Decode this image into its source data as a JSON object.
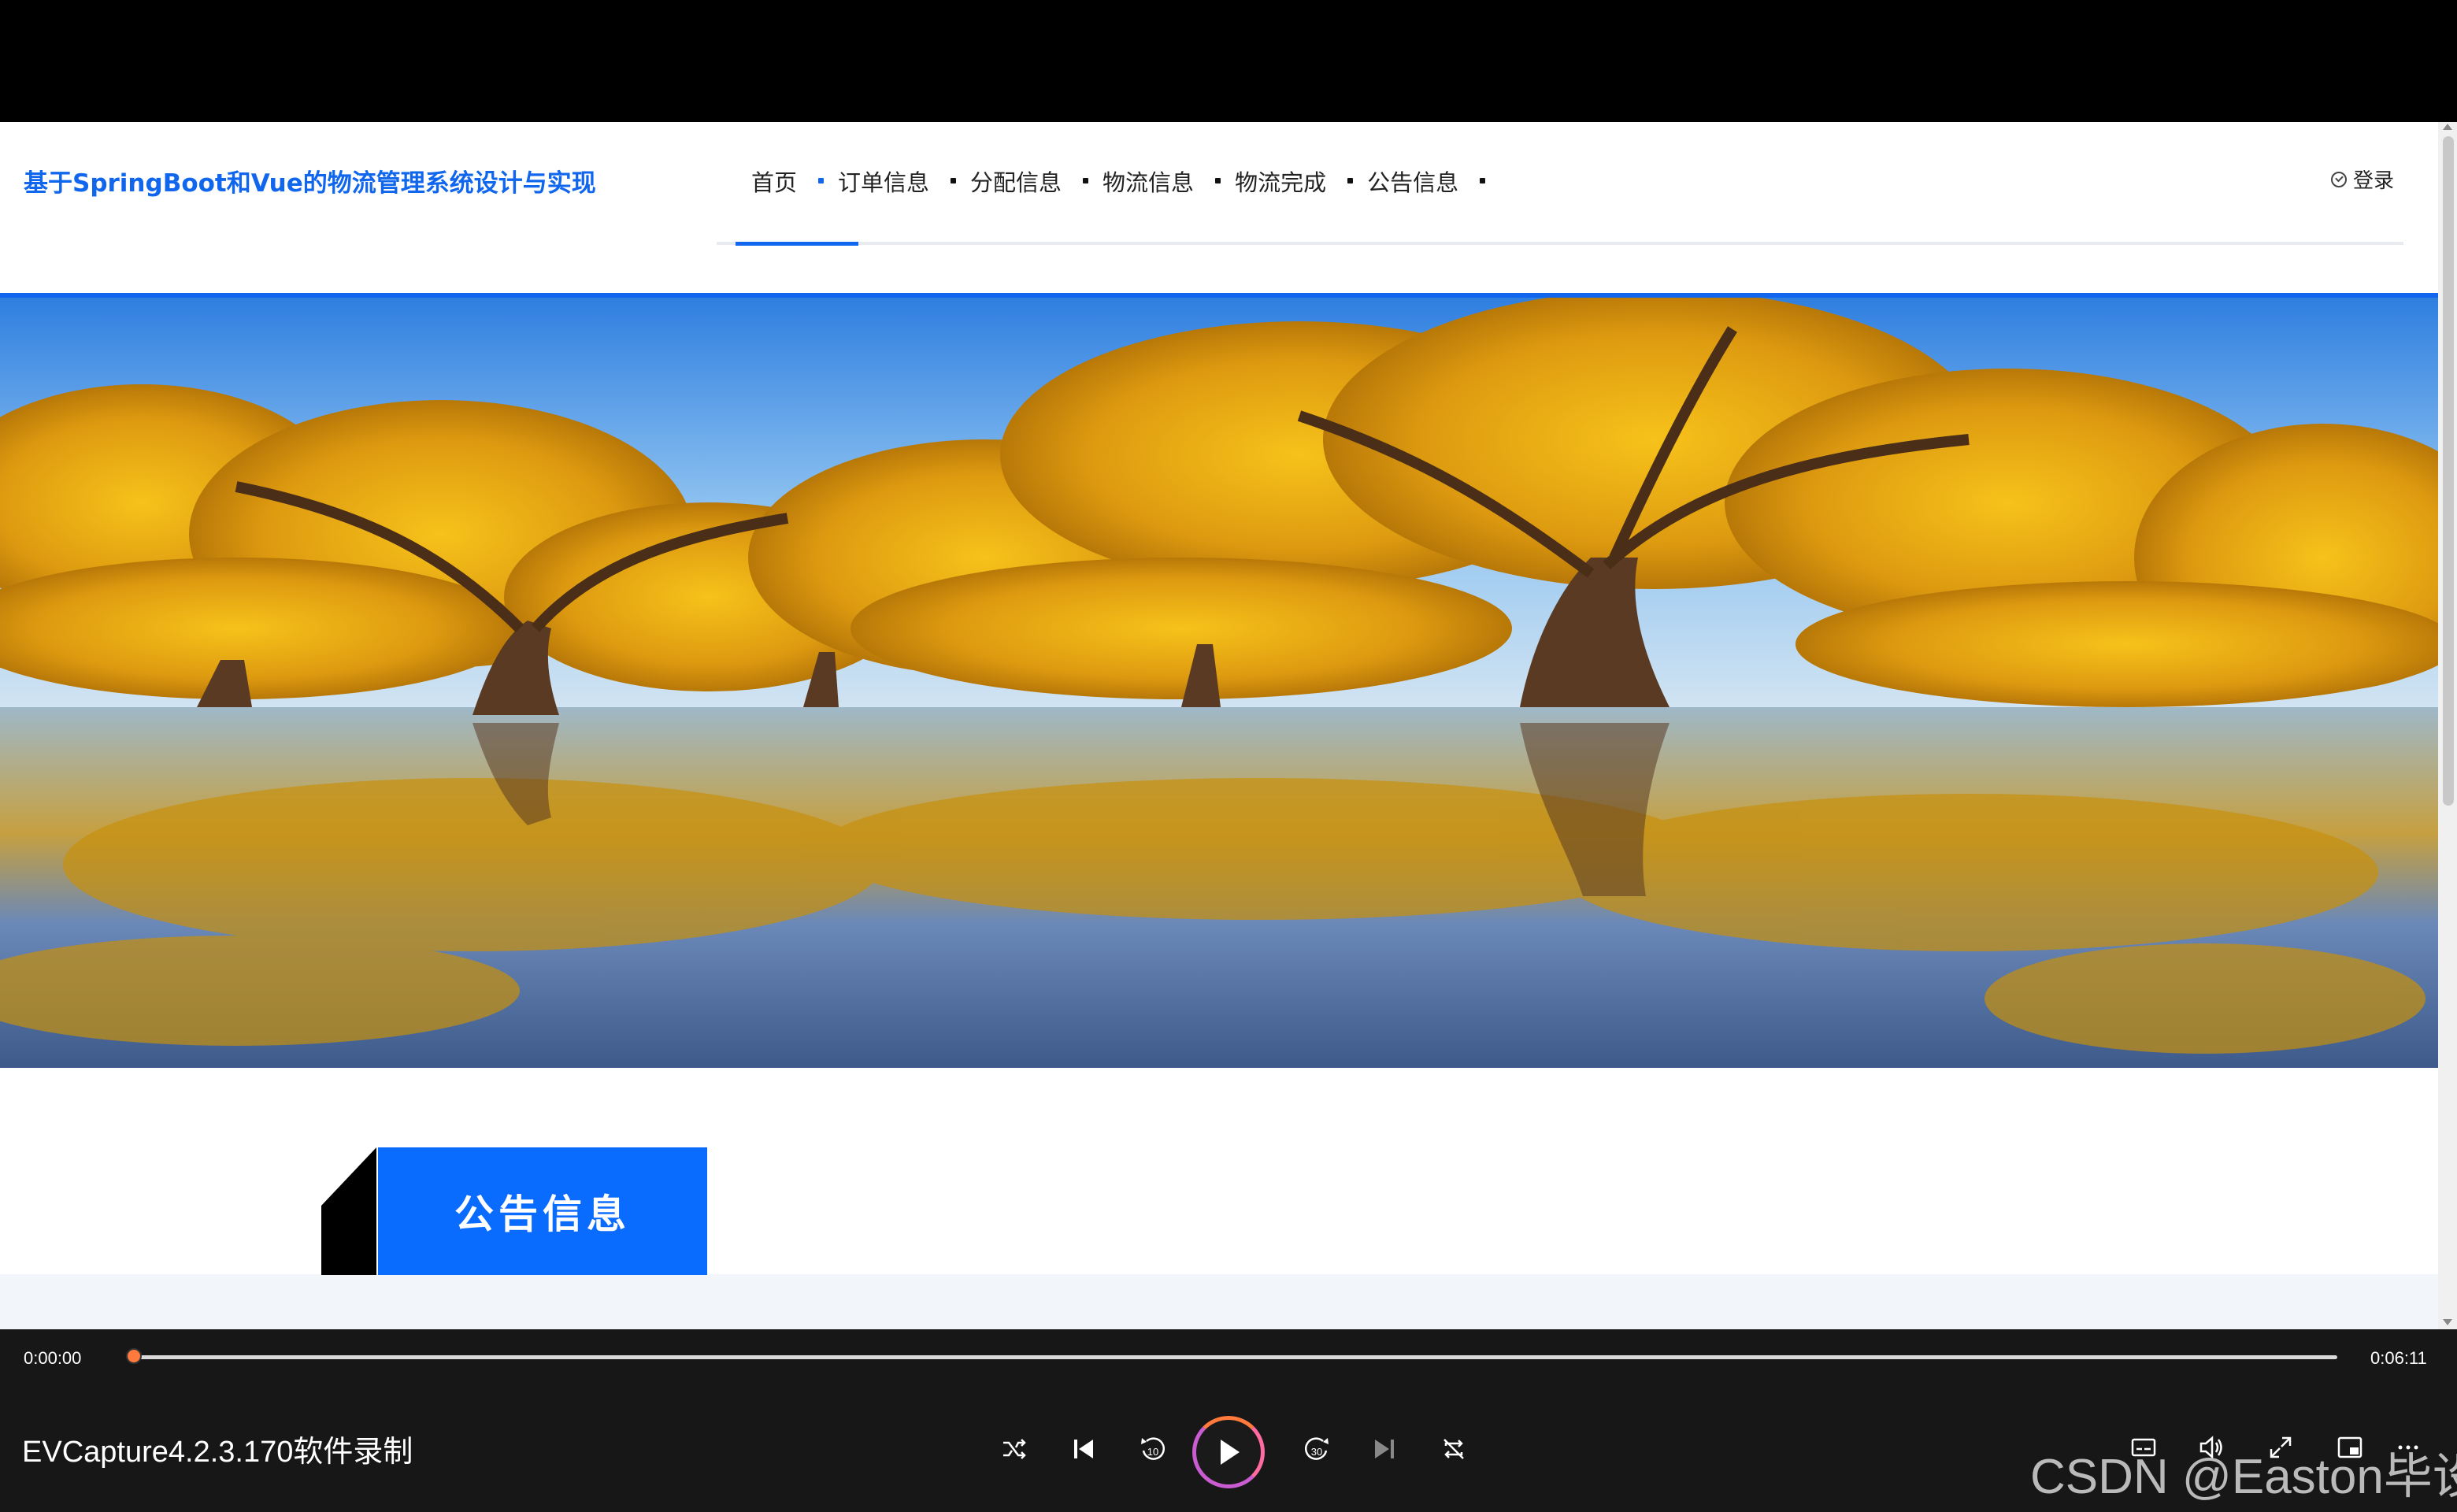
{
  "site": {
    "title": "基于SpringBoot和Vue的物流管理系统设计与实现",
    "nav": [
      "首页",
      "订单信息",
      "分配信息",
      "物流信息",
      "物流完成",
      "公告信息"
    ],
    "active_nav": "首页",
    "login_label": "登录"
  },
  "section": {
    "title": "公告信息"
  },
  "banner": {
    "image": "autumn poplar trees reflected in water",
    "slide_count": 1,
    "active_slide": 1
  },
  "colors": {
    "accent": "#1166ee",
    "section_bg": "#0a6bff",
    "player_bg": "#171717",
    "progress_knob": "#ff7a3c"
  },
  "player": {
    "current_time": "0:00:00",
    "total_time": "0:06:11",
    "progress": 0,
    "app_title": "EVCapture4.2.3.170软件录制",
    "controls": [
      "shuffle-icon",
      "previous-icon",
      "rewind-10-icon",
      "play-icon",
      "forward-30-icon",
      "next-icon",
      "repeat-icon",
      "subtitles-icon",
      "volume-icon",
      "fullscreen-icon",
      "miniplayer-icon",
      "more-icon"
    ],
    "rewind_label": "10",
    "forward_label": "30"
  },
  "watermark": "CSDN @Easton毕设"
}
